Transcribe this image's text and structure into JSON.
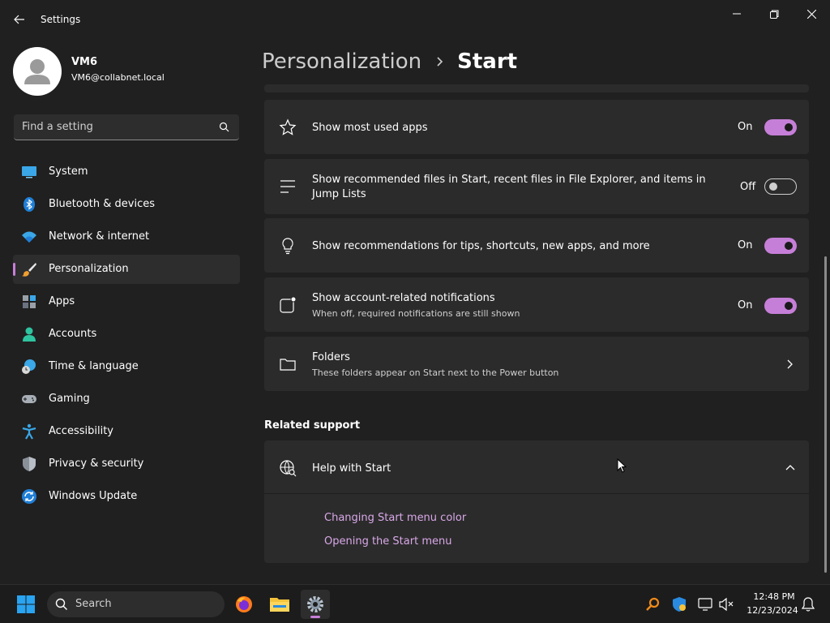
{
  "window": {
    "title": "Settings"
  },
  "user": {
    "name": "VM6",
    "email": "VM6@collabnet.local"
  },
  "search": {
    "placeholder": "Find a setting"
  },
  "sidebar": {
    "items": [
      {
        "label": "System",
        "icon": "monitor-icon"
      },
      {
        "label": "Bluetooth & devices",
        "icon": "bluetooth-icon"
      },
      {
        "label": "Network & internet",
        "icon": "wifi-icon"
      },
      {
        "label": "Personalization",
        "icon": "brush-icon",
        "active": true
      },
      {
        "label": "Apps",
        "icon": "apps-icon"
      },
      {
        "label": "Accounts",
        "icon": "person-icon"
      },
      {
        "label": "Time & language",
        "icon": "globe-clock-icon"
      },
      {
        "label": "Gaming",
        "icon": "gamepad-icon"
      },
      {
        "label": "Accessibility",
        "icon": "accessibility-icon"
      },
      {
        "label": "Privacy & security",
        "icon": "shield-icon"
      },
      {
        "label": "Windows Update",
        "icon": "update-icon"
      }
    ]
  },
  "breadcrumb": {
    "parent": "Personalization",
    "current": "Start"
  },
  "settings": [
    {
      "title": "Show most used apps",
      "state": "On",
      "on": true,
      "icon": "star-icon"
    },
    {
      "title": "Show recommended files in Start, recent files in File Explorer, and items in Jump Lists",
      "state": "Off",
      "on": false,
      "icon": "list-icon"
    },
    {
      "title": "Show recommendations for tips, shortcuts, new apps, and more",
      "state": "On",
      "on": true,
      "icon": "lightbulb-icon"
    },
    {
      "title": "Show account-related notifications",
      "subtitle": "When off, required notifications are still shown",
      "state": "On",
      "on": true,
      "icon": "notification-icon"
    }
  ],
  "folders": {
    "title": "Folders",
    "subtitle": "These folders appear on Start next to the Power button",
    "icon": "folder-icon"
  },
  "related_support": {
    "heading": "Related support",
    "help_title": "Help with Start",
    "links": [
      "Changing Start menu color",
      "Opening the Start menu"
    ]
  },
  "taskbar": {
    "search_label": "Search",
    "time": "12:48 PM",
    "date": "12/23/2024"
  },
  "colors": {
    "accent": "#c67fd8",
    "link": "#d9a8e8",
    "background": "#202020",
    "card": "#2b2b2b"
  }
}
